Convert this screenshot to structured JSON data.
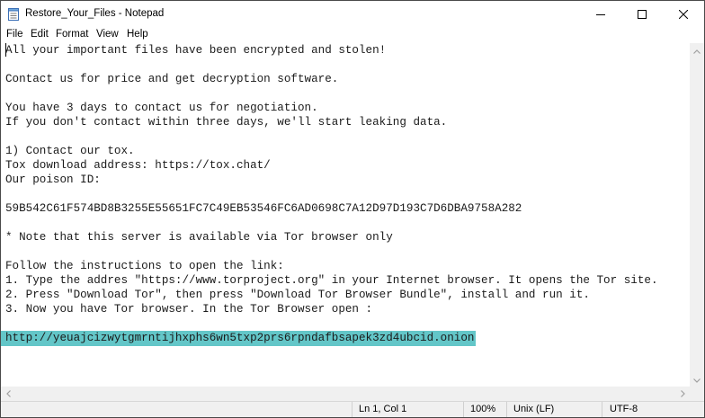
{
  "window": {
    "title": "Restore_Your_Files - Notepad"
  },
  "menu": [
    "File",
    "Edit",
    "Format",
    "View",
    "Help"
  ],
  "document": {
    "lines": [
      "All your important files have been encrypted and stolen!",
      "",
      "Contact us for price and get decryption software.",
      "",
      "You have 3 days to contact us for negotiation.",
      "If you don't contact within three days, we'll start leaking data.",
      "",
      "1) Contact our tox.",
      "Tox download address: https://tox.chat/",
      "Our poison ID:",
      "",
      "59B542C61F574BD8B3255E55651FC7C49EB53546FC6AD0698C7A12D97D193C7D6DBA9758A282",
      "",
      "* Note that this server is available via Tor browser only",
      "",
      "Follow the instructions to open the link:",
      "1. Type the addres \"https://www.torproject.org\" in your Internet browser. It opens the Tor site.",
      "2. Press \"Download Tor\", then press \"Download Tor Browser Bundle\", install and run it.",
      "3. Now you have Tor browser. In the Tor Browser open :",
      "",
      "http://yeuajcizwytgmrntijhxphs6wn5txp2prs6rpndafbsapek3zd4ubcid.onion"
    ],
    "selected_line_index": 20
  },
  "status": {
    "position": "Ln 1, Col 1",
    "zoom": "100%",
    "line_ending": "Unix (LF)",
    "encoding": "UTF-8"
  },
  "colors": {
    "selection": "#63c6c8",
    "statusbar_bg": "#f0f0f0"
  }
}
